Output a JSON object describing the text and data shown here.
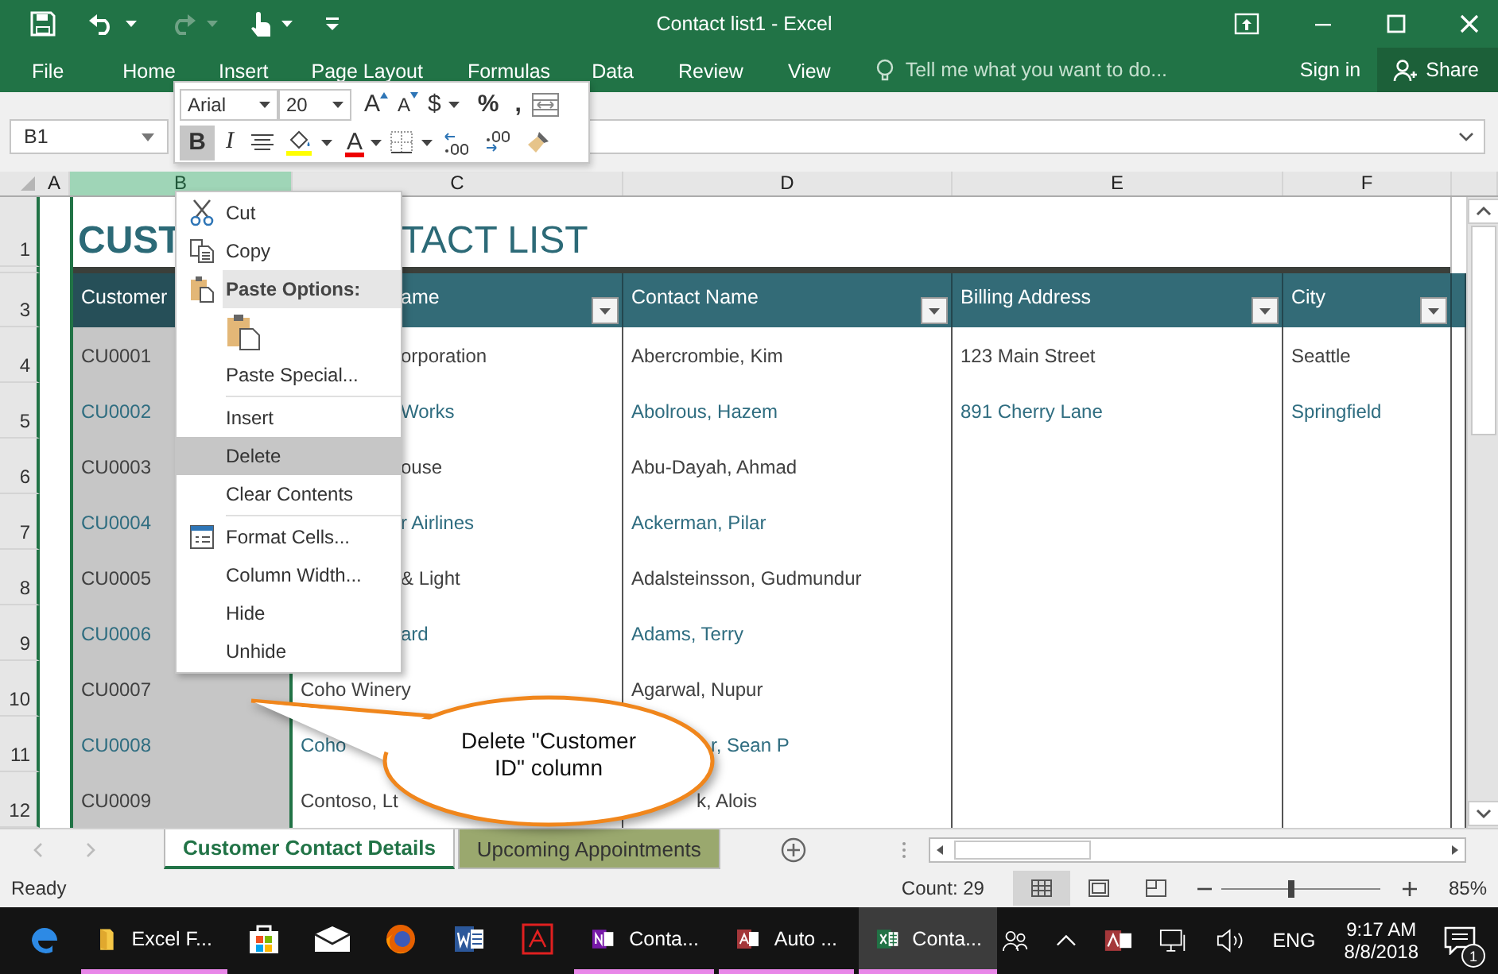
{
  "title_bar": {
    "title": "Contact list1 - Excel",
    "quick_access": [
      {
        "kind": "save",
        "disabled": false
      },
      {
        "kind": "undo",
        "disabled": false
      },
      {
        "kind": "redo",
        "disabled": true
      },
      {
        "kind": "touch",
        "disabled": false
      },
      {
        "kind": "customize",
        "disabled": false
      }
    ]
  },
  "ribbon": {
    "tabs": [
      {
        "label": "File",
        "selected": false
      },
      {
        "label": "Home",
        "selected": false
      },
      {
        "label": "Insert",
        "selected": false
      },
      {
        "label": "Page Layout",
        "selected": false
      },
      {
        "label": "Formulas",
        "selected": false
      },
      {
        "label": "Data",
        "selected": false
      },
      {
        "label": "Review",
        "selected": false
      },
      {
        "label": "View",
        "selected": false
      }
    ],
    "tell_me": {
      "placeholder": "Tell me what you want to do..."
    },
    "sign_in": "Sign in",
    "share": "Share"
  },
  "mini_toolbar": {
    "font": "Arial",
    "size": "20",
    "row_1": [
      {
        "kind": "grow-font",
        "label": "A",
        "selected": false
      },
      {
        "kind": "shrink-font",
        "label": "A",
        "selected": false
      },
      {
        "kind": "currency",
        "label": "$",
        "selected": false
      },
      {
        "kind": "percent",
        "label": "%",
        "selected": false
      },
      {
        "kind": "comma",
        "label": ",",
        "selected": false
      },
      {
        "kind": "merge",
        "selected": false
      }
    ],
    "row_2": [
      {
        "kind": "bold",
        "label": "B",
        "selected": true
      },
      {
        "kind": "italic",
        "label": "I",
        "selected": false
      },
      {
        "kind": "center",
        "selected": false
      },
      {
        "kind": "fill-color",
        "selected": false
      },
      {
        "kind": "font-color",
        "label": "A",
        "selected": false
      },
      {
        "kind": "borders",
        "selected": false
      },
      {
        "kind": "increase-decimal",
        "selected": false
      },
      {
        "kind": "decrease-decimal",
        "selected": false
      },
      {
        "kind": "format-painter",
        "selected": false
      }
    ]
  },
  "name_box": "B1",
  "columns": [
    {
      "label": "A",
      "selected": false
    },
    {
      "label": "B",
      "selected": true
    },
    {
      "label": "C",
      "selected": false
    },
    {
      "label": "D",
      "selected": false
    },
    {
      "label": "E",
      "selected": false
    },
    {
      "label": "F",
      "selected": false
    }
  ],
  "sheet": {
    "title_row": "1",
    "title_parts": [
      "CUST",
      "TACT LIST"
    ],
    "header_row": "3",
    "headers": [
      {
        "text": "Customer"
      },
      {
        "text": "ame"
      },
      {
        "text": "Contact Name"
      },
      {
        "text": "Billing Address"
      },
      {
        "text": "City"
      }
    ],
    "rows": [
      {
        "number": "4",
        "cells": [
          "CU0001",
          "orporation",
          "Abercrombie, Kim",
          "123 Main Street",
          "Seattle"
        ]
      },
      {
        "number": "5",
        "cells": [
          "CU0002",
          "Works",
          "Abolrous, Hazem",
          "891 Cherry Lane",
          "Springfield"
        ]
      },
      {
        "number": "6",
        "cells": [
          "CU0003",
          "ouse",
          "Abu-Dayah, Ahmad",
          "",
          ""
        ]
      },
      {
        "number": "7",
        "cells": [
          "CU0004",
          "r Airlines",
          "Ackerman, Pilar",
          "",
          ""
        ]
      },
      {
        "number": "8",
        "cells": [
          "CU0005",
          "& Light",
          "Adalsteinsson, Gudmundur",
          "",
          ""
        ]
      },
      {
        "number": "9",
        "cells": [
          "CU0006",
          "ard",
          "Adams, Terry",
          "",
          ""
        ]
      },
      {
        "number": "10",
        "cells": [
          "CU0007",
          "Coho Winery",
          "Agarwal, Nupur",
          "",
          ""
        ]
      },
      {
        "number": "11",
        "cells": [
          "CU0008",
          "Coho",
          "r, Sean P",
          "",
          ""
        ]
      },
      {
        "number": "12",
        "cells": [
          "CU0009",
          "Contoso, Lt",
          "k, Alois",
          "",
          ""
        ]
      }
    ]
  },
  "context_menu": [
    {
      "kind": "cut",
      "label": "Cut",
      "selected": false
    },
    {
      "kind": "copy",
      "label": "Copy",
      "selected": false
    },
    {
      "kind": "header",
      "label": "Paste Options:"
    },
    {
      "kind": "paste-choice",
      "selected": false
    },
    {
      "kind": "item",
      "label": "Paste Special...",
      "selected": false
    },
    {
      "kind": "separator"
    },
    {
      "kind": "item",
      "label": "Insert",
      "selected": false
    },
    {
      "kind": "item",
      "label": "Delete",
      "selected": true
    },
    {
      "kind": "item",
      "label": "Clear Contents",
      "selected": false
    },
    {
      "kind": "separator"
    },
    {
      "kind": "format-cells",
      "label": "Format Cells...",
      "selected": false
    },
    {
      "kind": "item",
      "label": "Column Width...",
      "selected": false
    },
    {
      "kind": "item",
      "label": "Hide",
      "selected": false
    },
    {
      "kind": "item",
      "label": "Unhide",
      "selected": false
    }
  ],
  "callout": {
    "text": "Delete \"Customer ID\" column"
  },
  "sheet_tabs": [
    {
      "label": "Customer Contact Details",
      "selected": true
    },
    {
      "label": "Upcoming Appointments",
      "selected": false,
      "color": "#9aa86e"
    }
  ],
  "status_bar": {
    "status": "Ready",
    "count": "Count: 29",
    "views": [
      {
        "kind": "normal",
        "selected": true
      },
      {
        "kind": "page-layout",
        "selected": false
      },
      {
        "kind": "page-break",
        "selected": false
      }
    ],
    "zoom": {
      "level": 0.44,
      "reading": "85%"
    }
  },
  "taskbar": {
    "items": [
      {
        "kind": "edge",
        "running": false,
        "selected": false
      },
      {
        "kind": "folder",
        "label": "Excel F...",
        "running": true,
        "selected": false
      },
      {
        "kind": "store",
        "running": false,
        "selected": false
      },
      {
        "kind": "mail",
        "running": false,
        "selected": false
      },
      {
        "kind": "firefox",
        "running": false,
        "selected": false
      },
      {
        "kind": "word",
        "running": false,
        "selected": false
      },
      {
        "kind": "pdf",
        "running": false,
        "selected": false
      },
      {
        "kind": "onenote",
        "label": "Conta...",
        "running": true,
        "selected": false
      },
      {
        "kind": "access",
        "label": "Auto ...",
        "running": true,
        "selected": false
      },
      {
        "kind": "excel",
        "label": "Conta...",
        "running": true,
        "selected": true
      }
    ],
    "language": "ENG",
    "time": "9:17 AM",
    "date": "8/8/2018",
    "notifications": "1"
  }
}
